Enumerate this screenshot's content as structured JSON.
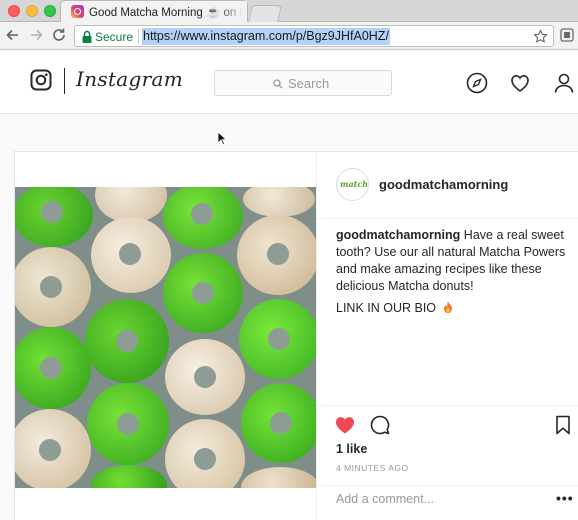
{
  "browser": {
    "tab_title": "Good Matcha Morning ☕ on Instagram",
    "secure_label": "Secure",
    "url": "https://www.instagram.com/p/Bgz9JHfA0HZ/"
  },
  "header": {
    "wordmark": "Instagram",
    "search_placeholder": "Search"
  },
  "post": {
    "avatar_text": "matcha",
    "username": "goodmatchamorning",
    "caption_username": "goodmatchamorning",
    "caption_text": " Have a real sweet tooth? Use our all natural Matcha Powers and make amazing recipes like these delicious Matcha donuts!",
    "caption_link": "LINK IN OUR BIO",
    "likes": "1 like",
    "time": "4 MINUTES AGO",
    "comment_placeholder": "Add a comment...",
    "more": "•••"
  },
  "icons": [
    "instagram-glyph-icon",
    "compass-icon",
    "heart-icon",
    "profile-icon",
    "comment-icon",
    "bookmark-icon",
    "fire-icon",
    "lock-icon",
    "star-icon"
  ],
  "colors": {
    "liked_heart": "#ed4956",
    "secure_green": "#0b8043",
    "url_highlight": "#b3d2f8"
  }
}
